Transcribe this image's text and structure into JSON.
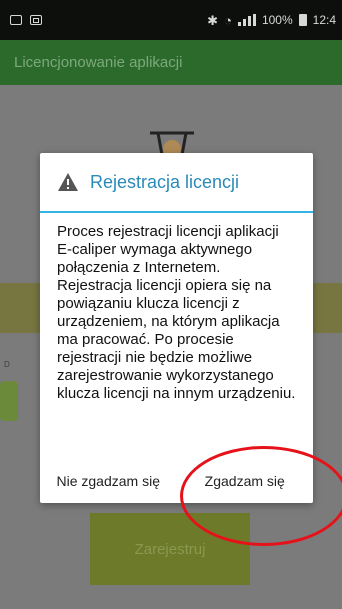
{
  "status_bar": {
    "left_icons": [
      "image-icon",
      "document-icon"
    ],
    "right_icons": [
      "bluetooth-icon",
      "wifi-icon",
      "signal-icon",
      "battery-icon"
    ],
    "battery": "100%",
    "time": "12:4"
  },
  "app_bar": {
    "title": "Licencjonowanie aplikacji"
  },
  "background": {
    "partial_text": "D",
    "register_button": "Zarejestruj"
  },
  "dialog": {
    "title": "Rejestracja licencji",
    "body": "Proces rejestracji licencji aplikacji E-caliper wymaga aktywnego połączenia z Internetem. Rejestracja licencji opiera się na powiązaniu klucza licencji z urządzeniem, na którym aplikacja ma pracować. Po procesie rejestracji nie będzie możliwe zarejestrowanie wykorzystanego klucza licencji na innym urządzeniu.",
    "decline": "Nie zgadzam się",
    "accept": "Zgadzam się"
  },
  "colors": {
    "app_bar": "#2b6a2b",
    "dialog_title": "#2a8ab8",
    "divider": "#33b5e5",
    "highlight": "#e6121a"
  }
}
